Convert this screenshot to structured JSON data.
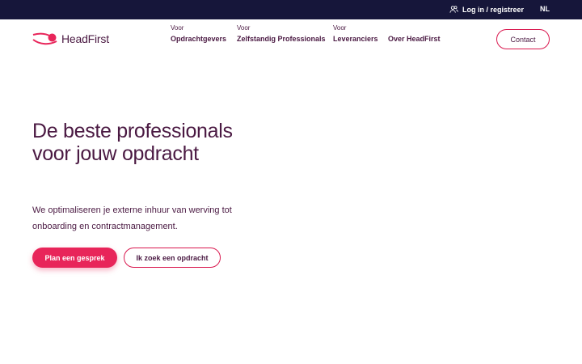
{
  "topbar": {
    "login_label": "Log in / registreer",
    "language": "NL",
    "login_icon": "users-icon"
  },
  "brand": {
    "name": "HeadFirst",
    "logo_icon": "headfirst-logo-icon",
    "color": "#e8255a"
  },
  "nav": {
    "items": [
      {
        "pre": "Voor",
        "label": "Opdrachtgevers"
      },
      {
        "pre": "Voor",
        "label": "Zelfstandig Professionals"
      },
      {
        "pre": "Voor",
        "label": "Leveranciers"
      },
      {
        "pre": "",
        "label": "Over HeadFirst"
      }
    ],
    "contact_label": "Contact"
  },
  "hero": {
    "title": "De beste professionals voor jouw opdracht",
    "text": "We optimaliseren je externe inhuur van werving tot onboarding en contractmanagement.",
    "primary_button": "Plan een gesprek",
    "secondary_button": "Ik zoek een opdracht"
  },
  "colors": {
    "topbar_bg": "#16163a",
    "text": "#4a1942",
    "accent": "#e8255a"
  }
}
